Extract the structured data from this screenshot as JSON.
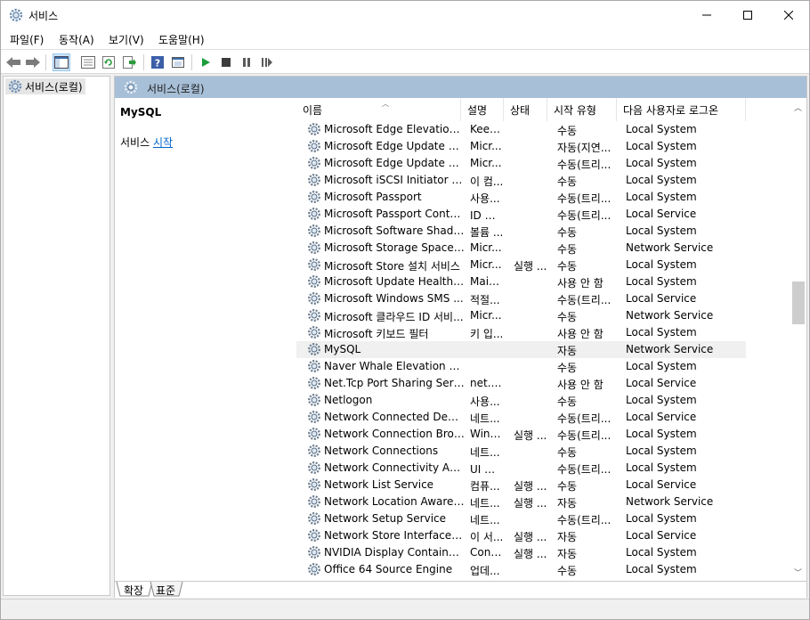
{
  "window": {
    "title": "서비스"
  },
  "menu": [
    "파일(F)",
    "동작(A)",
    "보기(V)",
    "도움말(H)"
  ],
  "tree": {
    "root_label": "서비스(로컬)"
  },
  "content": {
    "header_title": "서비스(로컬)",
    "selected_service": "MySQL",
    "action_prefix": "서비스 ",
    "action_link": "시작"
  },
  "columns": [
    "이름",
    "설명",
    "상태",
    "시작 유형",
    "다음 사용자로 로그온"
  ],
  "rows": [
    {
      "name": "Microsoft Edge Elevation S...",
      "desc": "Keep...",
      "status": "",
      "start": "수동",
      "logon": "Local System"
    },
    {
      "name": "Microsoft Edge Update Ser...",
      "desc": "Micr...",
      "status": "",
      "start": "자동(지연...",
      "logon": "Local System"
    },
    {
      "name": "Microsoft Edge Update Ser...",
      "desc": "Micr...",
      "status": "",
      "start": "수동(트리...",
      "logon": "Local System"
    },
    {
      "name": "Microsoft iSCSI Initiator Se...",
      "desc": "이 컴...",
      "status": "",
      "start": "수동",
      "logon": "Local System"
    },
    {
      "name": "Microsoft Passport",
      "desc": "사용...",
      "status": "",
      "start": "수동(트리...",
      "logon": "Local System"
    },
    {
      "name": "Microsoft Passport Container",
      "desc": "ID 공...",
      "status": "",
      "start": "수동(트리...",
      "logon": "Local Service"
    },
    {
      "name": "Microsoft Software Shado...",
      "desc": "볼륨 ...",
      "status": "",
      "start": "수동",
      "logon": "Local System"
    },
    {
      "name": "Microsoft Storage Spaces ...",
      "desc": "Micr...",
      "status": "",
      "start": "수동",
      "logon": "Network Service"
    },
    {
      "name": "Microsoft Store 설치 서비스",
      "desc": "Micr...",
      "status": "실행 ...",
      "start": "수동",
      "logon": "Local System"
    },
    {
      "name": "Microsoft Update Health S...",
      "desc": "Main...",
      "status": "",
      "start": "사용 안 함",
      "logon": "Local System"
    },
    {
      "name": "Microsoft Windows SMS ...",
      "desc": "적절...",
      "status": "",
      "start": "수동(트리...",
      "logon": "Local Service"
    },
    {
      "name": "Microsoft 클라우드 ID 서비...",
      "desc": "Micr...",
      "status": "",
      "start": "수동",
      "logon": "Network Service"
    },
    {
      "name": "Microsoft 키보드 필터",
      "desc": "키 입...",
      "status": "",
      "start": "사용 안 함",
      "logon": "Local System"
    },
    {
      "name": "MySQL",
      "desc": "",
      "status": "",
      "start": "자동",
      "logon": "Network Service"
    },
    {
      "name": "Naver Whale Elevation Serv...",
      "desc": "",
      "status": "",
      "start": "수동",
      "logon": "Local System"
    },
    {
      "name": "Net.Tcp Port Sharing Service",
      "desc": "net.t...",
      "status": "",
      "start": "사용 안 함",
      "logon": "Local Service"
    },
    {
      "name": "Netlogon",
      "desc": "사용...",
      "status": "",
      "start": "수동",
      "logon": "Local System"
    },
    {
      "name": "Network Connected Device...",
      "desc": "네트...",
      "status": "",
      "start": "수동(트리...",
      "logon": "Local Service"
    },
    {
      "name": "Network Connection Broker",
      "desc": "Wind...",
      "status": "실행 ...",
      "start": "수동(트리...",
      "logon": "Local System"
    },
    {
      "name": "Network Connections",
      "desc": "네트...",
      "status": "",
      "start": "수동",
      "logon": "Local System"
    },
    {
      "name": "Network Connectivity Assis...",
      "desc": "UI 구...",
      "status": "",
      "start": "수동(트리...",
      "logon": "Local System"
    },
    {
      "name": "Network List Service",
      "desc": "컴퓨...",
      "status": "실행 ...",
      "start": "수동",
      "logon": "Local Service"
    },
    {
      "name": "Network Location Awareness",
      "desc": "네트...",
      "status": "실행 ...",
      "start": "자동",
      "logon": "Network Service"
    },
    {
      "name": "Network Setup Service",
      "desc": "네트...",
      "status": "",
      "start": "수동(트리...",
      "logon": "Local System"
    },
    {
      "name": "Network Store Interface Se...",
      "desc": "이 서...",
      "status": "실행 ...",
      "start": "자동",
      "logon": "Local Service"
    },
    {
      "name": "NVIDIA Display Container LS",
      "desc": "Cont...",
      "status": "실행 ...",
      "start": "자동",
      "logon": "Local System"
    },
    {
      "name": "Office 64 Source Engine",
      "desc": "업데...",
      "status": "",
      "start": "수동",
      "logon": "Local System"
    }
  ],
  "selected_index": 13,
  "tabs": [
    "확장",
    "표준"
  ],
  "colors": {
    "header_bg": "#a7bfd7",
    "link": "#0066cc",
    "play_green": "#1a9e3a"
  }
}
